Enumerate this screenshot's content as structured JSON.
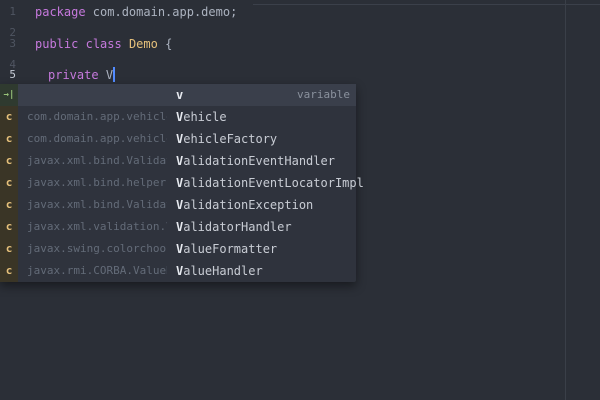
{
  "editor": {
    "line_numbers": [
      "1",
      "2",
      "3",
      "4",
      "5"
    ],
    "active_line": "5",
    "lines": {
      "l1_kw": "package",
      "l1_rest": " com.domain.app.demo;",
      "l3_kw1": "public",
      "l3_kw2": "class",
      "l3_cls": "Demo",
      "l3_rest": " {",
      "l5_kw": "private",
      "l5_typed": "V"
    }
  },
  "autocomplete": {
    "header": {
      "type_icon": "→|",
      "text": "v",
      "right_label": "variable"
    },
    "items": [
      {
        "type": "c",
        "left": "com.domain.app.vehicle…",
        "match": "V",
        "rest": "ehicle"
      },
      {
        "type": "c",
        "left": "com.domain.app.vehicle…",
        "match": "V",
        "rest": "ehicleFactory"
      },
      {
        "type": "c",
        "left": "javax.xml.bind.Validati…",
        "match": "V",
        "rest": "alidationEventHandler"
      },
      {
        "type": "c",
        "left": "javax.xml.bind.helpers…",
        "match": "V",
        "rest": "alidationEventLocatorImpl"
      },
      {
        "type": "c",
        "left": "javax.xml.bind.Validati…",
        "match": "V",
        "rest": "alidationException"
      },
      {
        "type": "c",
        "left": "javax.xml.validation.Va…",
        "match": "V",
        "rest": "alidatorHandler"
      },
      {
        "type": "c",
        "left": "javax.swing.colorchoose…",
        "match": "V",
        "rest": "alueFormatter"
      },
      {
        "type": "c",
        "left": "javax.rmi.CORBA.ValueHa…",
        "match": "V",
        "rest": "alueHandler"
      }
    ]
  },
  "colors": {
    "background": "#2b2f37",
    "keyword": "#c679dd",
    "class_name": "#e5c07b",
    "cursor": "#528bff"
  }
}
